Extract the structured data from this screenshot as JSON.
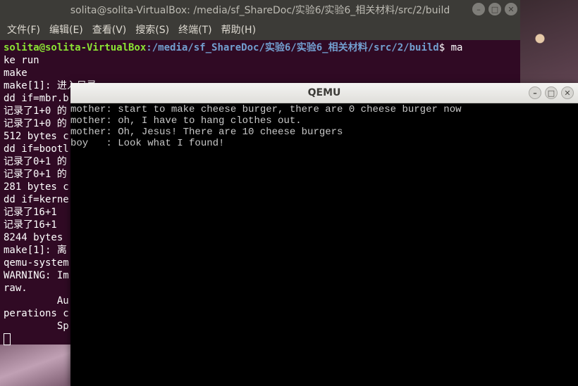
{
  "terminal": {
    "title": "solita@solita-VirtualBox: /media/sf_ShareDoc/实验6/实验6_相关材料/src/2/build",
    "menu": [
      "文件(F)",
      "编辑(E)",
      "查看(V)",
      "搜索(S)",
      "终端(T)",
      "帮助(H)"
    ],
    "prompt_user": "solita@solita-VirtualBox",
    "prompt_path": ":/media/sf_ShareDoc/实验6/实验6_相关材料/src/2/build",
    "prompt_cmd": "$ ma",
    "lines": [
      "ke run",
      "make",
      "make[1]: 进入目录",
      "dd if=mbr.b",
      "记录了1+0 的",
      "记录了1+0 的",
      "512 bytes c",
      "dd if=bootl",
      "记录了0+1 的",
      "记录了0+1 的",
      "281 bytes c",
      "dd if=kerne",
      "记录了16+1",
      "记录了16+1",
      "8244 bytes",
      "make[1]: 离",
      "qemu-system",
      "WARNING: Im",
      "raw.",
      "         Au",
      "perations c",
      "         Sp"
    ]
  },
  "qemu": {
    "title": "QEMU",
    "screen_lines": [
      "mother: start to make cheese burger, there are 0 cheese burger now",
      "mother: oh, I have to hang clothes out.",
      "mother: Oh, Jesus! There are 10 cheese burgers",
      "boy   : Look what I found!"
    ]
  }
}
